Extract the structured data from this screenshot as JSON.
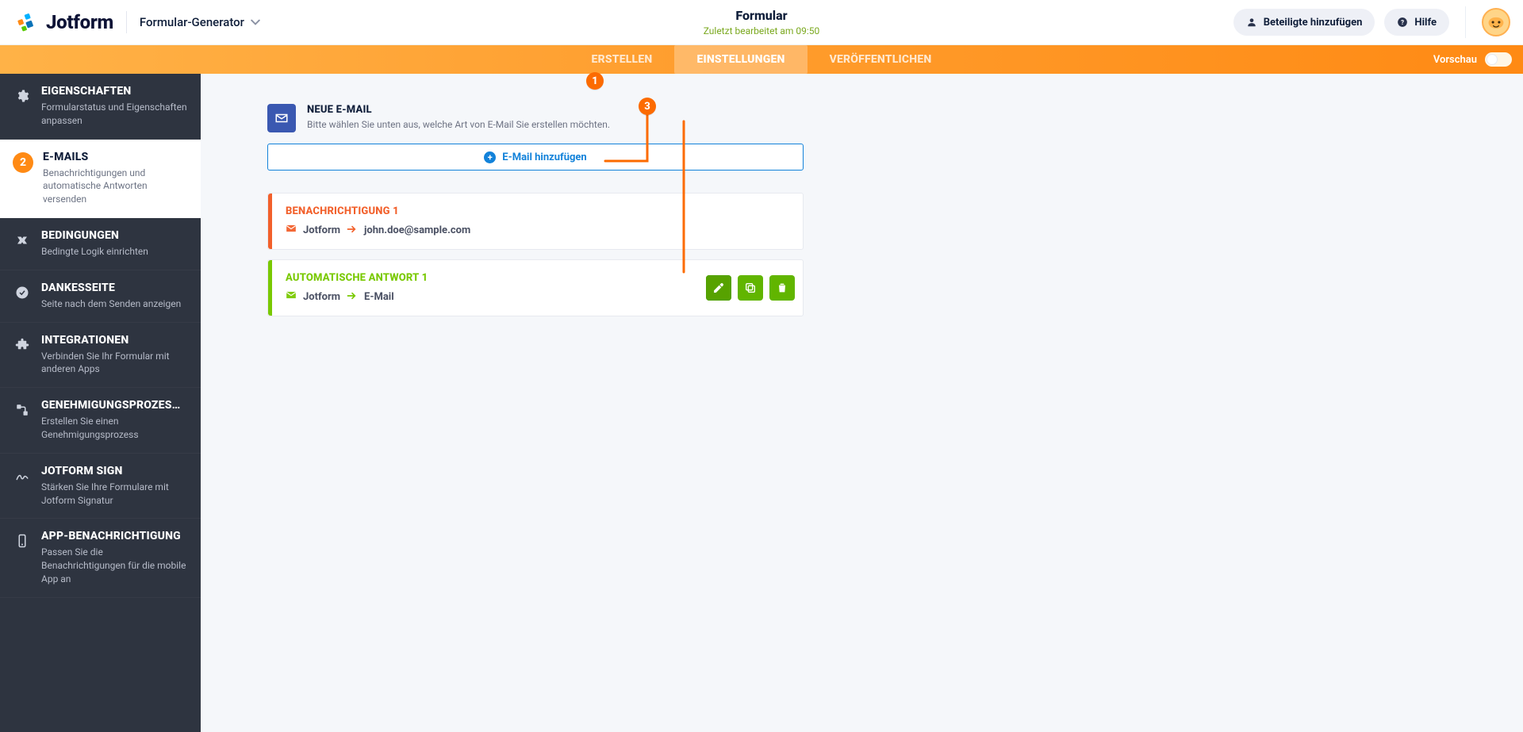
{
  "header": {
    "brand_name": "Jotform",
    "breadcrumb": "Formular-Generator",
    "form_title": "Formular",
    "form_subtitle": "Zuletzt bearbeitet am 09:50",
    "collaborate_label": "Beteiligte hinzufügen",
    "help_label": "Hilfe",
    "preview_label": "Vorschau"
  },
  "tabs": {
    "create": "ERSTELLEN",
    "settings": "EINSTELLUNGEN",
    "publish": "VERÖFFENTLICHEN"
  },
  "sidebar": {
    "items": [
      {
        "title": "EIGENSCHAFTEN",
        "subtitle": "Formularstatus und Eigenschaften anpassen"
      },
      {
        "title": "E-MAILS",
        "subtitle": "Benachrichtigungen und automatische Antworten versenden"
      },
      {
        "title": "BEDINGUNGEN",
        "subtitle": "Bedingte Logik einrichten"
      },
      {
        "title": "DANKESSEITE",
        "subtitle": "Seite nach dem Senden anzeigen"
      },
      {
        "title": "INTEGRATIONEN",
        "subtitle": "Verbinden Sie Ihr Formular mit anderen Apps"
      },
      {
        "title": "GENEHMIGUNGSPROZES…",
        "subtitle": "Erstellen Sie einen Genehmigungsprozess"
      },
      {
        "title": "JOTFORM SIGN",
        "subtitle": "Stärken Sie Ihre Formulare mit Jotform Signatur"
      },
      {
        "title": "APP-BENACHRICHTIGUNG",
        "subtitle": "Passen Sie die Benachrichtigungen für die mobile App an"
      }
    ],
    "active_badge": "2"
  },
  "section": {
    "title": "NEUE E-MAIL",
    "description": "Bitte wählen Sie unten aus, welche Art von E-Mail Sie erstellen möchten."
  },
  "add_button": {
    "label": "E-Mail hinzufügen"
  },
  "emails": [
    {
      "type": "notification",
      "title": "BENACHRICHTIGUNG 1",
      "from": "Jotform",
      "to": "john.doe@sample.com"
    },
    {
      "type": "autoresponder",
      "title": "AUTOMATISCHE ANTWORT 1",
      "from": "Jotform",
      "to": "E-Mail"
    }
  ],
  "markers": {
    "one": "1",
    "two": "2",
    "three": "3"
  },
  "colors": {
    "marker": "#fc6b00",
    "notif": "#f2602b",
    "auto": "#79c900",
    "blue": "#1282da"
  }
}
